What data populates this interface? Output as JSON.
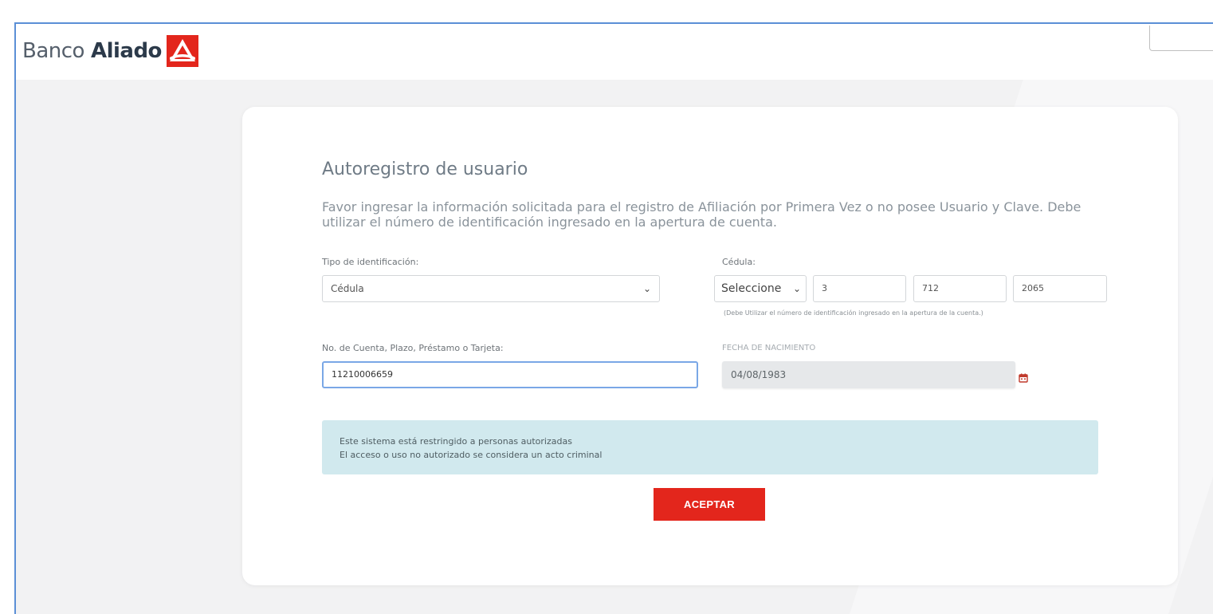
{
  "header": {
    "logo": {
      "word1": "Banco",
      "word2": "Aliado"
    },
    "colors": {
      "brand_red": "#e3261c",
      "logo_dark": "#2c3a4a"
    }
  },
  "form": {
    "title": "Autoregistro de usuario",
    "intro": "Favor ingresar la información solicitada para el registro de Afiliación por Primera Vez o no posee Usuario y Clave. Debe utilizar el número de identificación ingresado en la apertura de cuenta.",
    "tipo_identificacion": {
      "label": "Tipo de identificación:",
      "value": "Cédula"
    },
    "cedula": {
      "label": "Cédula:",
      "select_value": "Seleccione",
      "part1": "3",
      "part2": "712",
      "part3": "2065",
      "hint": "(Debe Utilizar el número de identificación ingresado en la apertura de la cuenta.)"
    },
    "cuenta": {
      "label": "No. de Cuenta, Plazo, Préstamo o Tarjeta:",
      "value": "11210006659"
    },
    "fecha_nacimiento": {
      "label": "FECHA DE NACIMIENTO",
      "value": "04/08/1983",
      "icon": "calendar-icon"
    },
    "alert": {
      "line1": "Este sistema está restringido a personas autorizadas",
      "line2": "El acceso o uso no autorizado se considera un acto criminal"
    },
    "submit_label": "ACEPTAR"
  }
}
